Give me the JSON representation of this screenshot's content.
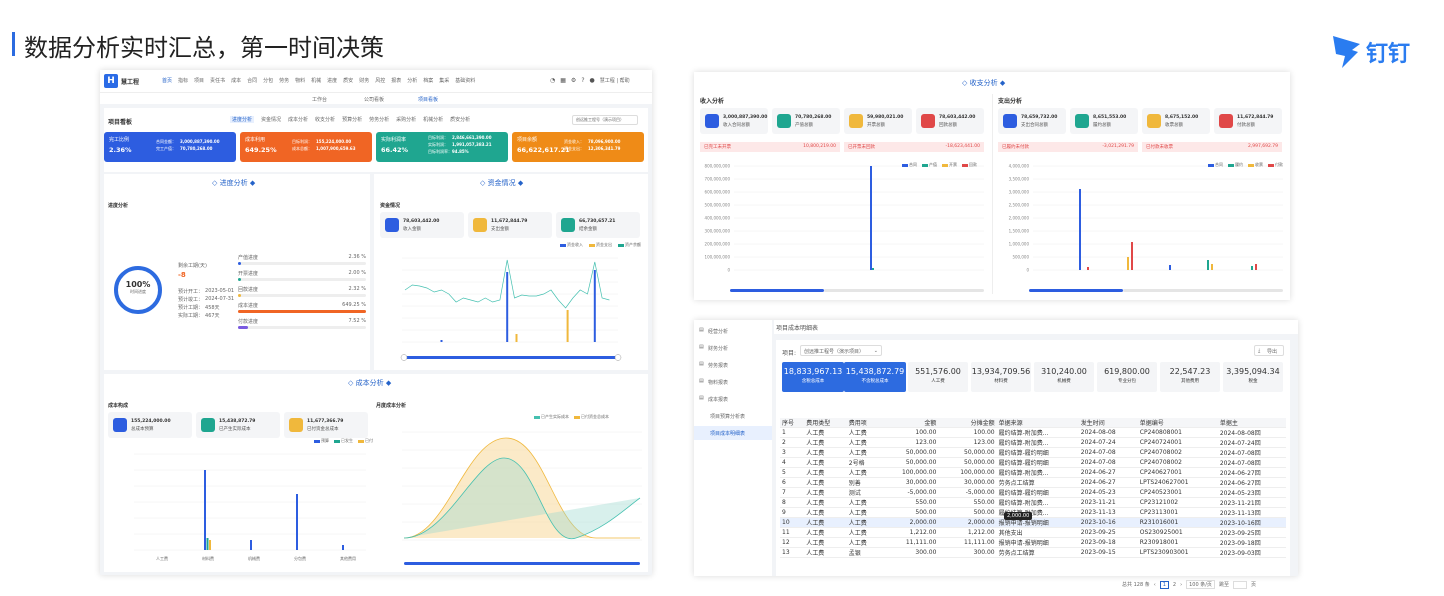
{
  "headline": "数据分析实时汇总，第一时间决策",
  "brand": "钉钉",
  "app": {
    "name": "慧工程",
    "user": "慧工程 | 帮助",
    "nav": [
      "首页",
      "指标",
      "项目",
      "责任书",
      "成本",
      "合同",
      "分包",
      "劳务",
      "物料",
      "机械",
      "进度",
      "质安",
      "财务",
      "风控",
      "报表",
      "分析",
      "档案",
      "集采",
      "基础资料"
    ],
    "subnav": [
      "工作台",
      "公司看板",
      "项目看板"
    ]
  },
  "board": {
    "title": "项目看板",
    "tabs": [
      "进度分析",
      "资金情况",
      "成本分析",
      "收支分析",
      "预算分析",
      "劳务分析",
      "采购分析",
      "机械分析",
      "质安分析"
    ],
    "project_select": "创远推工程号（演示项目）",
    "kpis": [
      {
        "name": "完工比例",
        "value": "2.36%",
        "l1": "合同金额：",
        "v1": "3,000,887,390.00",
        "l2": "完工产值：",
        "v2": "70,780,268.00",
        "color": "#2d5de0"
      },
      {
        "name": "成本利用",
        "value": "649.25%",
        "l1": "目标利润：",
        "v1": "155,224,000.00",
        "l2": "成本总额：",
        "v2": "1,007,900,659.63",
        "color": "#f06524"
      },
      {
        "name": "实际利润率",
        "value": "66.42%",
        "l1": "目标利润：",
        "v1": "2,846,661,390.00",
        "l2": "实际利润：",
        "v2": "1,991,057,383.21",
        "l3": "目标利润率：",
        "v3": "94.85%",
        "color": "#1fa690"
      },
      {
        "name": "项目余额",
        "value": "66,622,617.21",
        "l1": "资金收入：",
        "v1": "78,096,900.00",
        "l2": "资金支出：",
        "v2": "12,306,341.79",
        "color": "#ef8b17"
      }
    ]
  },
  "progress": {
    "section": "进度分析",
    "title": "进度分析",
    "ring": "100%",
    "ring_label": "时间进度",
    "remain_label": "剩余工期(天)",
    "remain": "-8",
    "dates": [
      [
        "预计开工：",
        "2023-05-01"
      ],
      [
        "预计竣工：",
        "2024-07-31"
      ],
      [
        "预计工期：",
        "458天"
      ],
      [
        "实际工期：",
        "467天"
      ]
    ],
    "bars": [
      {
        "name": "产值进度",
        "pct": "2.36 %",
        "v": 2.36,
        "color": "#2d5de0"
      },
      {
        "name": "开票进度",
        "pct": "2.00 %",
        "v": 2,
        "color": "#1fa690"
      },
      {
        "name": "回款进度",
        "pct": "2.32 %",
        "v": 2.32,
        "color": "#f0b83c"
      },
      {
        "name": "成本进度",
        "pct": "649.25 %",
        "v": 100,
        "color": "#f06524"
      },
      {
        "name": "付款进度",
        "pct": "7.52 %",
        "v": 7.52,
        "color": "#7a5ae0"
      }
    ]
  },
  "fund": {
    "section": "资金情况",
    "title": "资金情况",
    "cards": [
      {
        "amount": "78,603,442.00",
        "label": "收入金额",
        "color": "#2d5de0"
      },
      {
        "amount": "11,672,844.79",
        "label": "支出金额",
        "color": "#f0b83c"
      },
      {
        "amount": "66,730,657.21",
        "label": "结余金额",
        "color": "#1fa690"
      }
    ],
    "legend": [
      "资金收入",
      "资金支出",
      "资产余额"
    ]
  },
  "cost": {
    "section": "成本分析",
    "title": "成本构成",
    "monthly": "月度成本分析",
    "cards": [
      {
        "amount": "155,224,000.00",
        "label": "总成本预算",
        "color": "#2d5de0"
      },
      {
        "amount": "15,438,872.79",
        "label": "已产生实际成本",
        "color": "#1fa690"
      },
      {
        "amount": "11,677,366.79",
        "label": "已付资金总成本",
        "color": "#f0b83c"
      }
    ],
    "legend": [
      "预算",
      "已发生",
      "已付"
    ],
    "legend2": [
      "已产生实际成本",
      "已付资金总成本"
    ],
    "cats": [
      "人工费",
      "材料费",
      "机械费",
      "分包费",
      "其他费用"
    ]
  },
  "income": {
    "section": "收支分析",
    "in_title": "收入分析",
    "out_title": "支出分析",
    "in_cards": [
      {
        "amount": "3,000,887,390.00",
        "label": "收入合同总额",
        "color": "#2d5de0"
      },
      {
        "amount": "70,780,268.00",
        "label": "产值总额",
        "color": "#1fa690"
      },
      {
        "amount": "59,980,021.00",
        "label": "开票总额",
        "color": "#f0b83c"
      },
      {
        "amount": "78,603,442.00",
        "label": "回款总额",
        "color": "#e04848"
      }
    ],
    "out_cards": [
      {
        "amount": "78,659,732.00",
        "label": "支出合同总额",
        "color": "#2d5de0"
      },
      {
        "amount": "8,651,553.00",
        "label": "履约总额",
        "color": "#1fa690"
      },
      {
        "amount": "8,675,152.00",
        "label": "收票总额",
        "color": "#f0b83c"
      },
      {
        "amount": "11,672,844.79",
        "label": "付款总额",
        "color": "#e04848"
      }
    ],
    "in_alerts": [
      [
        "已完工未开票",
        "10,800,219.00"
      ],
      [
        "已开票未回款",
        "-18,623,441.00"
      ]
    ],
    "out_alerts": [
      [
        "已履约未付款",
        "-3,021,291.79"
      ],
      [
        "已付款未收票",
        "2,997,692.79"
      ]
    ],
    "legend_in": [
      "合同",
      "产值",
      "开票",
      "回款"
    ],
    "legend_out": [
      "合同",
      "履约",
      "收票",
      "付款"
    ],
    "in_y": [
      "800,000,000",
      "700,000,000",
      "600,000,000",
      "500,000,000",
      "400,000,000",
      "300,000,000",
      "200,000,000",
      "100,000,000",
      "0"
    ],
    "out_y": [
      "4,000,000",
      "3,500,000",
      "3,000,000",
      "2,500,000",
      "2,000,000",
      "1,500,000",
      "1,000,000",
      "500,000",
      "0"
    ]
  },
  "detail": {
    "side": [
      "经营分析",
      "财务分析",
      "劳务报表",
      "物料报表",
      "成本报表",
      "项目预算分析表",
      "项目成本明细表"
    ],
    "title": "项目成本明细表",
    "project_label": "项目:",
    "project": "创远推工程号（演示项目）",
    "export": "导出",
    "sums": [
      {
        "v": "18,833,967.13",
        "l": "含税总成本"
      },
      {
        "v": "15,438,872.79",
        "l": "不含税总成本"
      },
      {
        "v": "551,576.00",
        "l": "人工费"
      },
      {
        "v": "13,934,709.56",
        "l": "材料费"
      },
      {
        "v": "310,240.00",
        "l": "机械费"
      },
      {
        "v": "619,800.00",
        "l": "专业分包"
      },
      {
        "v": "22,547.23",
        "l": "其他费用"
      },
      {
        "v": "3,395,094.34",
        "l": "税金"
      }
    ],
    "cols": [
      "序号",
      "费用类型",
      "费用项",
      "金额",
      "分摊金额",
      "单据来源",
      "发生时间",
      "单据编号",
      "单据主"
    ],
    "rows": [
      [
        "1",
        "人工费",
        "人工费",
        "100.00",
        "100.00",
        "履约结算-附加费...",
        "2024-08-08",
        "CP240808001",
        "2024-08-08回"
      ],
      [
        "2",
        "人工费",
        "人工费",
        "123.00",
        "123.00",
        "履约结算-附加费...",
        "2024-07-24",
        "CP240724001",
        "2024-07-24回"
      ],
      [
        "3",
        "人工费",
        "人工费",
        "50,000.00",
        "50,000.00",
        "履约结算-履约明细",
        "2024-07-08",
        "CP240708002",
        "2024-07-08回"
      ],
      [
        "4",
        "人工费",
        "2号格",
        "50,000.00",
        "50,000.00",
        "履约结算-履约明细",
        "2024-07-08",
        "CP240708002",
        "2024-07-08回"
      ],
      [
        "5",
        "人工费",
        "人工费",
        "100,000.00",
        "100,000.00",
        "履约结算-附加费...",
        "2024-06-27",
        "CP240627001",
        "2024-06-27回"
      ],
      [
        "6",
        "人工费",
        "别善",
        "30,000.00",
        "30,000.00",
        "劳务点工结算",
        "2024-06-27",
        "LPTS240627001",
        "2024-06-27回"
      ],
      [
        "7",
        "人工费",
        "测试",
        "-5,000.00",
        "-5,000.00",
        "履约结算-履约明细",
        "2024-05-23",
        "CP240523001",
        "2024-05-23回"
      ],
      [
        "8",
        "人工费",
        "人工费",
        "550.00",
        "550.00",
        "履约结算-附加费...",
        "2023-11-21",
        "CP23121002",
        "2023-11-21回"
      ],
      [
        "9",
        "人工费",
        "人工费",
        "500.00",
        "500.00",
        "履约结算-附加费...",
        "2023-11-13",
        "CP23113001",
        "2023-11-13回"
      ],
      [
        "10",
        "人工费",
        "人工费",
        "2,000.00",
        "2,000.00",
        "报销申请-报销明细",
        "2023-10-16",
        "R231016001",
        "2023-10-16回"
      ],
      [
        "11",
        "人工费",
        "人工费",
        "1,212.00",
        "1,212.00",
        "其他支出",
        "2023-09-25",
        "OS230925001",
        "2023-09-25回"
      ],
      [
        "12",
        "人工费",
        "人工费",
        "11,111.00",
        "11,111.00",
        "报销申请-报销明细",
        "2023-09-18",
        "R230918001",
        "2023-09-18回"
      ],
      [
        "13",
        "人工费",
        "孟银",
        "300.00",
        "300.00",
        "劳务点工结算",
        "2023-09-15",
        "LPTS230903001",
        "2023-09-03回"
      ]
    ],
    "tooltip": "2,000.00",
    "total": "总共 128 条",
    "pages": [
      "1",
      "2"
    ],
    "pagesize": "100 条/页",
    "goto": "跳至",
    "page_unit": "页"
  }
}
